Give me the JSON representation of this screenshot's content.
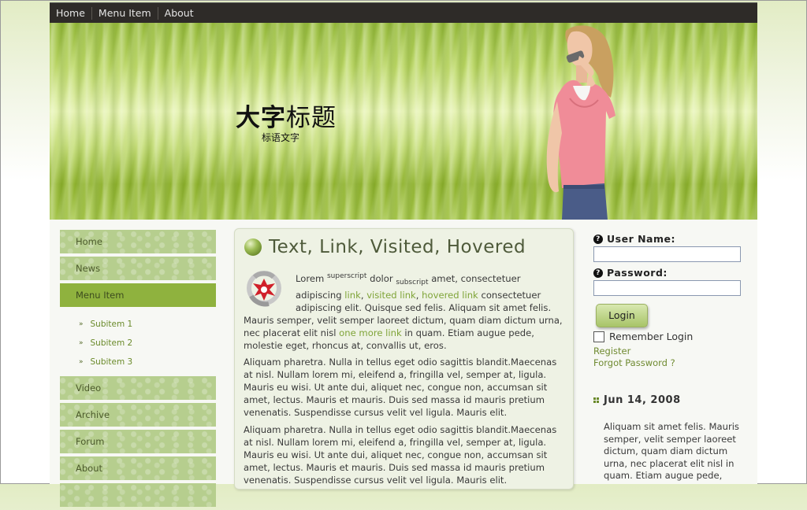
{
  "top_nav": [
    "Home",
    "Menu Item",
    "About"
  ],
  "banner": {
    "title_bold": "大字",
    "title_rest": "标题",
    "subtitle": "标语文字"
  },
  "sidebar": {
    "items": [
      "Home",
      "News",
      "Menu Item"
    ],
    "subitems": [
      "Subitem 1",
      "Subitem 2",
      "Subitem 3"
    ],
    "items_after": [
      "Video",
      "Archive",
      "Forum",
      "About"
    ]
  },
  "main": {
    "title": {
      "w1": "Text,",
      "w2": "Link,",
      "w3": "Visited,",
      "w4": "Hovered"
    },
    "p1": {
      "t1": "Lorem ",
      "sup": "superscript",
      "t2": " dolor ",
      "sub": "subscript",
      "t3": " amet, consectetuer adipiscing ",
      "link": "link",
      "c1": ", ",
      "visited": "visited link",
      "c2": ", ",
      "hovered": "hovered link",
      "t4": " consectetuer adipiscing elit. Quisque sed felis. Aliquam sit amet felis. Mauris semper, velit semper laoreet dictum, quam diam dictum urna, nec placerat elit nisl ",
      "more": "one more link",
      "t5": " in quam. Etiam augue pede, molestie eget, rhoncus at, convallis ut, eros."
    },
    "p2": "Aliquam pharetra. Nulla in tellus eget odio sagittis blandit.Maecenas at nisl. Nullam lorem mi, eleifend a, fringilla vel, semper at, ligula. Mauris eu wisi. Ut ante dui, aliquet nec, congue non, accumsan sit amet, lectus. Mauris et mauris. Duis sed massa id mauris pretium venenatis. Suspendisse cursus velit vel ligula. Mauris elit.",
    "p3": "Aliquam pharetra. Nulla in tellus eget odio sagittis blandit.Maecenas at nisl. Nullam lorem mi, eleifend a, fringilla vel, semper at, ligula. Mauris eu wisi. Ut ante dui, aliquet nec, congue non, accumsan sit amet, lectus. Mauris et mauris. Duis sed massa id mauris pretium venenatis. Suspendisse cursus velit vel ligula. Mauris elit."
  },
  "login": {
    "user_label": "User Name:",
    "pass_label": "Password:",
    "button": "Login",
    "remember": "Remember Login",
    "register": "Register",
    "forgot": "Forgot Password ?"
  },
  "news": {
    "date": "Jun 14, 2008",
    "text": "Aliquam sit amet felis. Mauris semper, velit semper laoreet dictum, quam diam dictum urna, nec placerat elit nisl in quam. Etiam augue pede,"
  },
  "colors": {
    "accent_link": "#7fa438",
    "nav_bg": "#2e2b28",
    "sidebar_item": "#b6ce8e",
    "sidebar_active": "#8fb23e"
  },
  "icons": [
    "help-icon",
    "orb-icon",
    "logo-icon",
    "bullet-icon",
    "date-icon"
  ]
}
